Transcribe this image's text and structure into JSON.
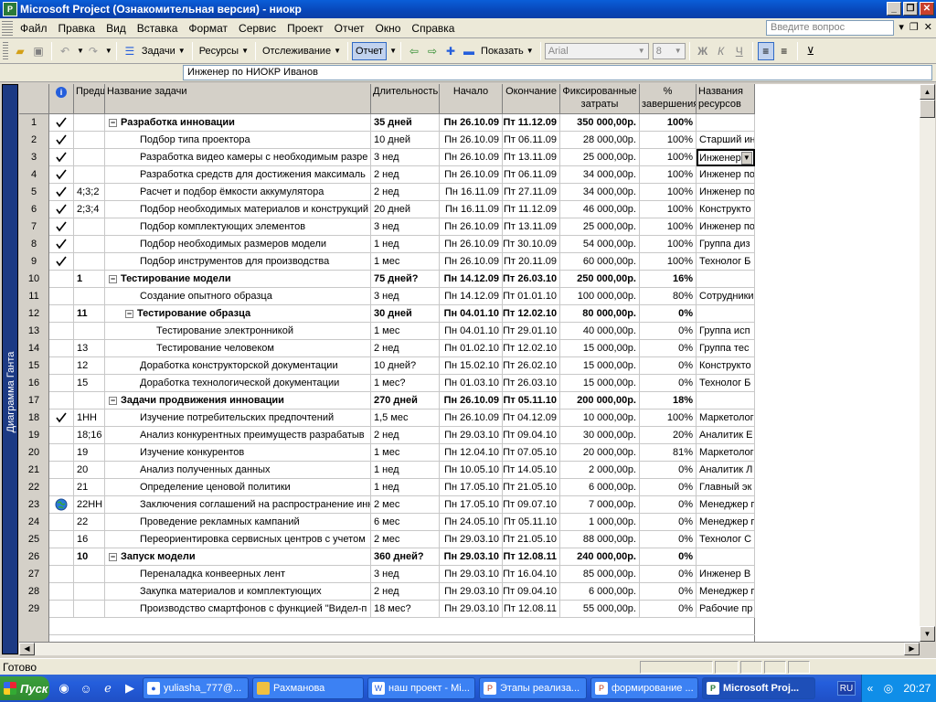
{
  "window": {
    "title": "Microsoft Project (Ознакомительная версия) - ниокр"
  },
  "menu": {
    "items": [
      "Файл",
      "Правка",
      "Вид",
      "Вставка",
      "Формат",
      "Сервис",
      "Проект",
      "Отчет",
      "Окно",
      "Справка"
    ],
    "help_placeholder": "Введите вопрос"
  },
  "toolbar": {
    "tasks": "Задачи",
    "resources": "Ресурсы",
    "tracking": "Отслеживание",
    "report": "Отчет",
    "show": "Показать",
    "font": "Arial",
    "font_size": "8"
  },
  "entry_bar": {
    "value": "Инженер по НИОКР Иванов"
  },
  "view_bar": {
    "label": "Диаграмма Ганта"
  },
  "table": {
    "headers": {
      "pred": "Предшественники",
      "name": "Название задачи",
      "duration": "Длительность",
      "start": "Начало",
      "finish": "Окончание",
      "cost": "Фиксированные затраты",
      "pct": "% завершения",
      "res": "Названия ресурсов"
    },
    "rows": [
      {
        "id": "1",
        "ind": "check",
        "pred": "",
        "name": "Разработка инновации",
        "dur": "35 дней",
        "start": "Пн 26.10.09",
        "finish": "Пт 11.12.09",
        "cost": "350 000,00р.",
        "pct": "100%",
        "res": "",
        "summary": true,
        "level": 0
      },
      {
        "id": "2",
        "ind": "check",
        "pred": "",
        "name": "Подбор типа проектора",
        "dur": "10 дней",
        "start": "Пн 26.10.09",
        "finish": "Пт 06.11.09",
        "cost": "28 000,00р.",
        "pct": "100%",
        "res": "Старший ин",
        "summary": false,
        "level": 1
      },
      {
        "id": "3",
        "ind": "check",
        "pred": "",
        "name": "Разработка видео камеры с необходимым разре",
        "dur": "3 нед",
        "start": "Пн 26.10.09",
        "finish": "Пт 13.11.09",
        "cost": "25 000,00р.",
        "pct": "100%",
        "res": "Инженер",
        "summary": false,
        "level": 1,
        "selected": true
      },
      {
        "id": "4",
        "ind": "check",
        "pred": "",
        "name": "Разработка средств для достижения максималь",
        "dur": "2 нед",
        "start": "Пн 26.10.09",
        "finish": "Пт 06.11.09",
        "cost": "34 000,00р.",
        "pct": "100%",
        "res": "Инженер по",
        "summary": false,
        "level": 1
      },
      {
        "id": "5",
        "ind": "check",
        "pred": "4;3;2",
        "name": "Расчет и подбор ёмкости аккумулятора",
        "dur": "2 нед",
        "start": "Пн 16.11.09",
        "finish": "Пт 27.11.09",
        "cost": "34 000,00р.",
        "pct": "100%",
        "res": "Инженер по",
        "summary": false,
        "level": 1
      },
      {
        "id": "6",
        "ind": "check",
        "pred": "2;3;4",
        "name": "Подбор необходимых материалов и конструкций",
        "dur": "20 дней",
        "start": "Пн 16.11.09",
        "finish": "Пт 11.12.09",
        "cost": "46 000,00р.",
        "pct": "100%",
        "res": "Конструкто",
        "summary": false,
        "level": 1
      },
      {
        "id": "7",
        "ind": "check",
        "pred": "",
        "name": "Подбор комплектующих элементов",
        "dur": "3 нед",
        "start": "Пн 26.10.09",
        "finish": "Пт 13.11.09",
        "cost": "25 000,00р.",
        "pct": "100%",
        "res": "Инженер по",
        "summary": false,
        "level": 1
      },
      {
        "id": "8",
        "ind": "check",
        "pred": "",
        "name": "Подбор необходимых размеров модели",
        "dur": "1 нед",
        "start": "Пн 26.10.09",
        "finish": "Пт 30.10.09",
        "cost": "54 000,00р.",
        "pct": "100%",
        "res": "Группа диз",
        "summary": false,
        "level": 1
      },
      {
        "id": "9",
        "ind": "check",
        "pred": "",
        "name": "Подбор инструментов для производства",
        "dur": "1 мес",
        "start": "Пн 26.10.09",
        "finish": "Пт 20.11.09",
        "cost": "60 000,00р.",
        "pct": "100%",
        "res": "Технолог Б",
        "summary": false,
        "level": 1
      },
      {
        "id": "10",
        "ind": "",
        "pred": "1",
        "name": "Тестирование модели",
        "dur": "75 дней?",
        "start": "Пн 14.12.09",
        "finish": "Пт 26.03.10",
        "cost": "250 000,00р.",
        "pct": "16%",
        "res": "",
        "summary": true,
        "level": 0
      },
      {
        "id": "11",
        "ind": "",
        "pred": "",
        "name": "Создание опытного образца",
        "dur": "3 нед",
        "start": "Пн 14.12.09",
        "finish": "Пт 01.01.10",
        "cost": "100 000,00р.",
        "pct": "80%",
        "res": "Сотрудники",
        "summary": false,
        "level": 1
      },
      {
        "id": "12",
        "ind": "",
        "pred": "11",
        "name": "Тестирование образца",
        "dur": "30 дней",
        "start": "Пн 04.01.10",
        "finish": "Пт 12.02.10",
        "cost": "80 000,00р.",
        "pct": "0%",
        "res": "",
        "summary": true,
        "level": 1
      },
      {
        "id": "13",
        "ind": "",
        "pred": "",
        "name": "Тестирование электронникой",
        "dur": "1 мес",
        "start": "Пн 04.01.10",
        "finish": "Пт 29.01.10",
        "cost": "40 000,00р.",
        "pct": "0%",
        "res": "Группа исп",
        "summary": false,
        "level": 2
      },
      {
        "id": "14",
        "ind": "",
        "pred": "13",
        "name": "Тестирование человеком",
        "dur": "2 нед",
        "start": "Пн 01.02.10",
        "finish": "Пт 12.02.10",
        "cost": "15 000,00р.",
        "pct": "0%",
        "res": "Группа тес",
        "summary": false,
        "level": 2
      },
      {
        "id": "15",
        "ind": "",
        "pred": "12",
        "name": "Доработка конструкторской документации",
        "dur": "10 дней?",
        "start": "Пн 15.02.10",
        "finish": "Пт 26.02.10",
        "cost": "15 000,00р.",
        "pct": "0%",
        "res": "Конструкто",
        "summary": false,
        "level": 1
      },
      {
        "id": "16",
        "ind": "",
        "pred": "15",
        "name": "Доработка технологической документации",
        "dur": "1 мес?",
        "start": "Пн 01.03.10",
        "finish": "Пт 26.03.10",
        "cost": "15 000,00р.",
        "pct": "0%",
        "res": "Технолог Б",
        "summary": false,
        "level": 1
      },
      {
        "id": "17",
        "ind": "",
        "pred": "",
        "name": "Задачи продвижения инновации",
        "dur": "270 дней",
        "start": "Пн 26.10.09",
        "finish": "Пт 05.11.10",
        "cost": "200 000,00р.",
        "pct": "18%",
        "res": "",
        "summary": true,
        "level": 0
      },
      {
        "id": "18",
        "ind": "check",
        "pred": "1НН",
        "name": "Изучение потребительских предпочтений",
        "dur": "1,5 мес",
        "start": "Пн 26.10.09",
        "finish": "Пт 04.12.09",
        "cost": "10 000,00р.",
        "pct": "100%",
        "res": "Маркетолог",
        "summary": false,
        "level": 1
      },
      {
        "id": "19",
        "ind": "",
        "pred": "18;16",
        "name": "Анализ конкурентных преимуществ разрабатыв",
        "dur": "2 нед",
        "start": "Пн 29.03.10",
        "finish": "Пт 09.04.10",
        "cost": "30 000,00р.",
        "pct": "20%",
        "res": "Аналитик Е",
        "summary": false,
        "level": 1
      },
      {
        "id": "20",
        "ind": "",
        "pred": "19",
        "name": "Изучение конкурентов",
        "dur": "1 мес",
        "start": "Пн 12.04.10",
        "finish": "Пт 07.05.10",
        "cost": "20 000,00р.",
        "pct": "81%",
        "res": "Маркетолог",
        "summary": false,
        "level": 1
      },
      {
        "id": "21",
        "ind": "",
        "pred": "20",
        "name": "Анализ полученных данных",
        "dur": "1 нед",
        "start": "Пн 10.05.10",
        "finish": "Пт 14.05.10",
        "cost": "2 000,00р.",
        "pct": "0%",
        "res": "Аналитик Л",
        "summary": false,
        "level": 1
      },
      {
        "id": "22",
        "ind": "",
        "pred": "21",
        "name": "Определение ценовой политики",
        "dur": "1 нед",
        "start": "Пн 17.05.10",
        "finish": "Пт 21.05.10",
        "cost": "6 000,00р.",
        "pct": "0%",
        "res": "Главный эк",
        "summary": false,
        "level": 1
      },
      {
        "id": "23",
        "ind": "globe",
        "pred": "22НН",
        "name": "Заключения соглашений на распространение инн",
        "dur": "2 мес",
        "start": "Пн 17.05.10",
        "finish": "Пт 09.07.10",
        "cost": "7 000,00р.",
        "pct": "0%",
        "res": "Менеджер п",
        "summary": false,
        "level": 1
      },
      {
        "id": "24",
        "ind": "",
        "pred": "22",
        "name": "Проведение рекламных кампаний",
        "dur": "6 мес",
        "start": "Пн 24.05.10",
        "finish": "Пт 05.11.10",
        "cost": "1 000,00р.",
        "pct": "0%",
        "res": "Менеджер п",
        "summary": false,
        "level": 1
      },
      {
        "id": "25",
        "ind": "",
        "pred": "16",
        "name": "Переориентировка сервисных центров с учетом",
        "dur": "2 мес",
        "start": "Пн 29.03.10",
        "finish": "Пт 21.05.10",
        "cost": "88 000,00р.",
        "pct": "0%",
        "res": "Технолог С",
        "summary": false,
        "level": 1
      },
      {
        "id": "26",
        "ind": "",
        "pred": "10",
        "name": "Запуск модели",
        "dur": "360 дней?",
        "start": "Пн 29.03.10",
        "finish": "Пт 12.08.11",
        "cost": "240 000,00р.",
        "pct": "0%",
        "res": "",
        "summary": true,
        "level": 0
      },
      {
        "id": "27",
        "ind": "",
        "pred": "",
        "name": "Переналадка конвеерных лент",
        "dur": "3 нед",
        "start": "Пн 29.03.10",
        "finish": "Пт 16.04.10",
        "cost": "85 000,00р.",
        "pct": "0%",
        "res": "Инженер В",
        "summary": false,
        "level": 1
      },
      {
        "id": "28",
        "ind": "",
        "pred": "",
        "name": "Закупка материалов и комплектующих",
        "dur": "2 нед",
        "start": "Пн 29.03.10",
        "finish": "Пт 09.04.10",
        "cost": "6 000,00р.",
        "pct": "0%",
        "res": "Менеджер п",
        "summary": false,
        "level": 1
      },
      {
        "id": "29",
        "ind": "",
        "pred": "",
        "name": "Производство смартфонов с функцией \"Видел-п",
        "dur": "18 мес?",
        "start": "Пн 29.03.10",
        "finish": "Пт 12.08.11",
        "cost": "55 000,00р.",
        "pct": "0%",
        "res": "Рабочие пр",
        "summary": false,
        "level": 1
      }
    ]
  },
  "status": {
    "text": "Готово"
  },
  "taskbar": {
    "start": "Пуск",
    "buttons": [
      {
        "label": "yuliasha_777@...",
        "active": false
      },
      {
        "label": "Рахманова",
        "active": false
      },
      {
        "label": "наш проект - Mi...",
        "active": false
      },
      {
        "label": "Этапы реализа...",
        "active": false
      },
      {
        "label": "формирование ...",
        "active": false
      },
      {
        "label": "Microsoft Proj...",
        "active": true
      }
    ],
    "lang": "RU",
    "clock": "20:27"
  },
  "colors": {
    "title_blue": "#0846b8",
    "view_bar": "#1c3a84",
    "taskbar_blue": "#245edc",
    "start_green": "#2f8b2f"
  }
}
